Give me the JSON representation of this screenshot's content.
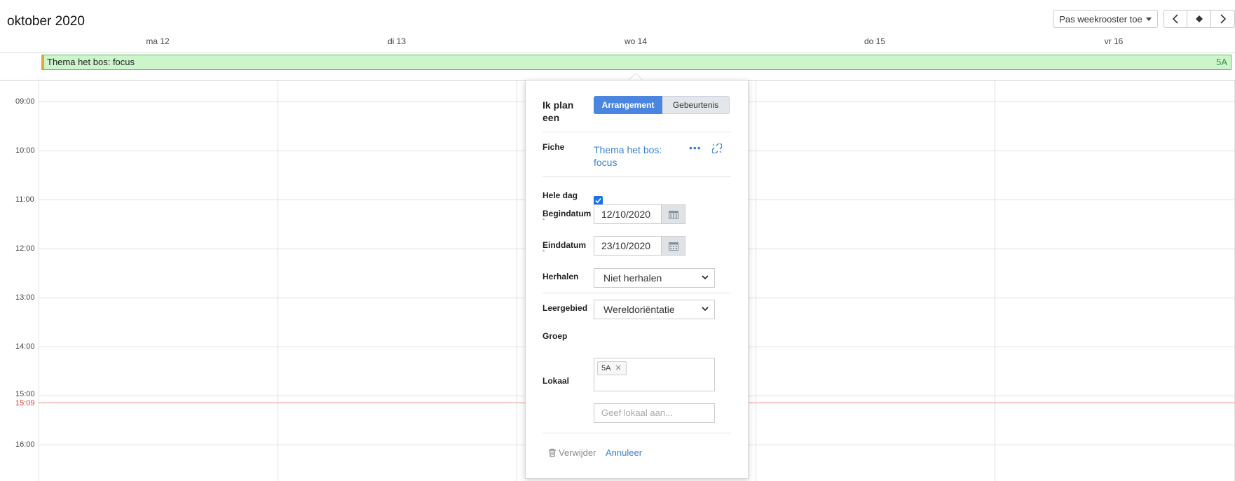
{
  "header": {
    "title": "oktober 2020"
  },
  "toolbar": {
    "week_select_label": "Pas weekrooster toe",
    "prev_icon": "chevron-left-icon",
    "today_icon": "diamond-icon",
    "next_icon": "chevron-right-icon"
  },
  "days": [
    "ma 12",
    "di 13",
    "wo 14",
    "do 15",
    "vr 16"
  ],
  "event": {
    "title": "Thema het bos: focus",
    "group": "5A",
    "color": "#ccf5cc",
    "border_color": "#5cbd5c",
    "accent": "#e7a43b"
  },
  "times": [
    "09:00",
    "10:00",
    "11:00",
    "12:00",
    "13:00",
    "14:00",
    "15:00",
    "16:00"
  ],
  "now": {
    "label": "15:09",
    "color": "#e23b3b"
  },
  "form": {
    "plan_label": "Ik plan een",
    "type_options": [
      "Arrangement",
      "Gebeurtenis"
    ],
    "type_selected": "Arrangement",
    "fiche_label": "Fiche",
    "fiche_value": "Thema het bos: focus",
    "fiche_more_icon": "more-dots-icon",
    "fiche_unlink_icon": "unlink-icon",
    "hele_dag_label": "Hele dag",
    "hele_dag_checked": true,
    "begin_label": "Begindatum",
    "begin_value": "12/10/2020",
    "end_label": "Einddatum",
    "end_value": "23/10/2020",
    "required_marker": "*",
    "herhalen_label": "Herhalen",
    "herhalen_value": "Niet herhalen",
    "leergebied_label": "Leergebied",
    "leergebied_value": "Wereldoriëntatie",
    "groep_label": "Groep",
    "groep_tags": [
      "5A"
    ],
    "lokaal_label": "Lokaal",
    "lokaal_placeholder": "Geef lokaal aan...",
    "delete_label": "Verwijder",
    "cancel_label": "Annuleer",
    "accent_color": "#4a86e0",
    "link_color": "#3b82d6"
  }
}
